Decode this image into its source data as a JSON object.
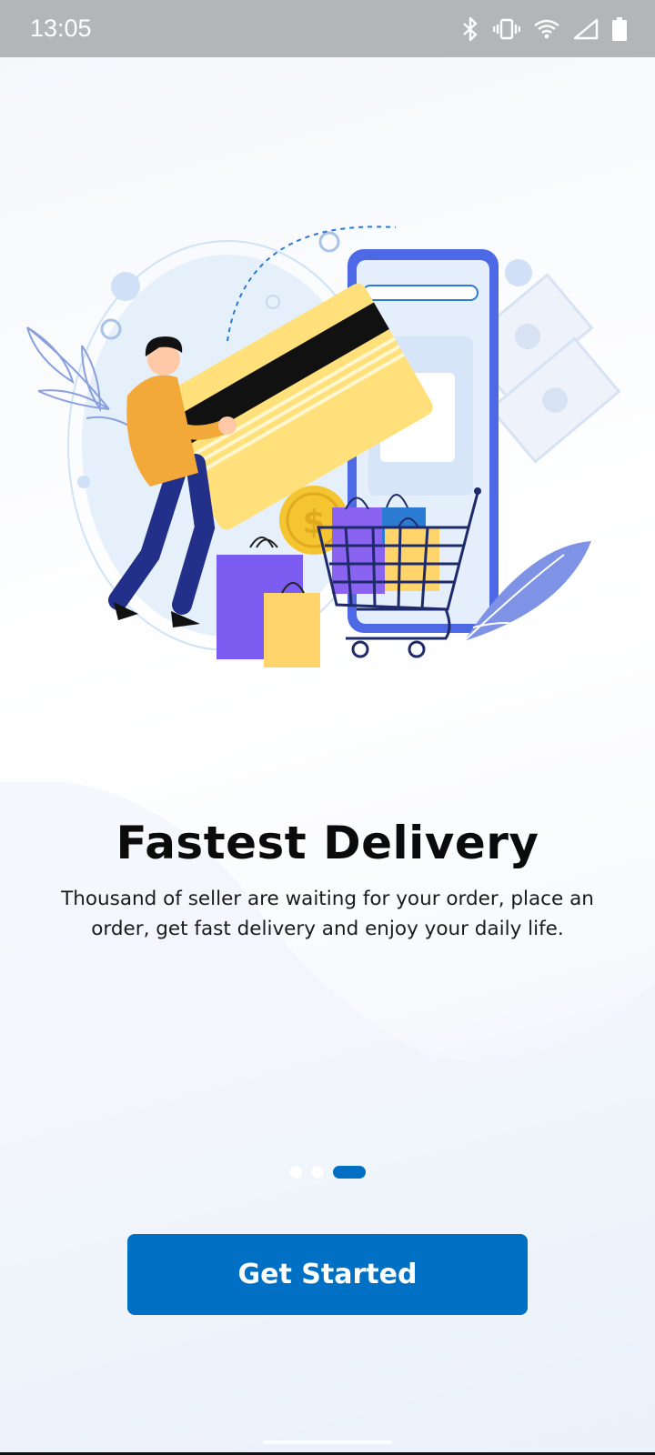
{
  "status_bar": {
    "time": "13:05",
    "icons": [
      "bluetooth-icon",
      "vibrate-icon",
      "wifi-icon",
      "signal-icon",
      "battery-icon"
    ]
  },
  "onboarding": {
    "title": "Fastest Delivery",
    "description": "Thousand of seller are waiting for your order, place an order, get fast delivery and enjoy your daily life.",
    "page_indicator": {
      "total": 3,
      "active": 3
    },
    "cta_label": "Get Started"
  },
  "colors": {
    "accent": "#0070c4",
    "status_bar": "#b3b5b8"
  }
}
